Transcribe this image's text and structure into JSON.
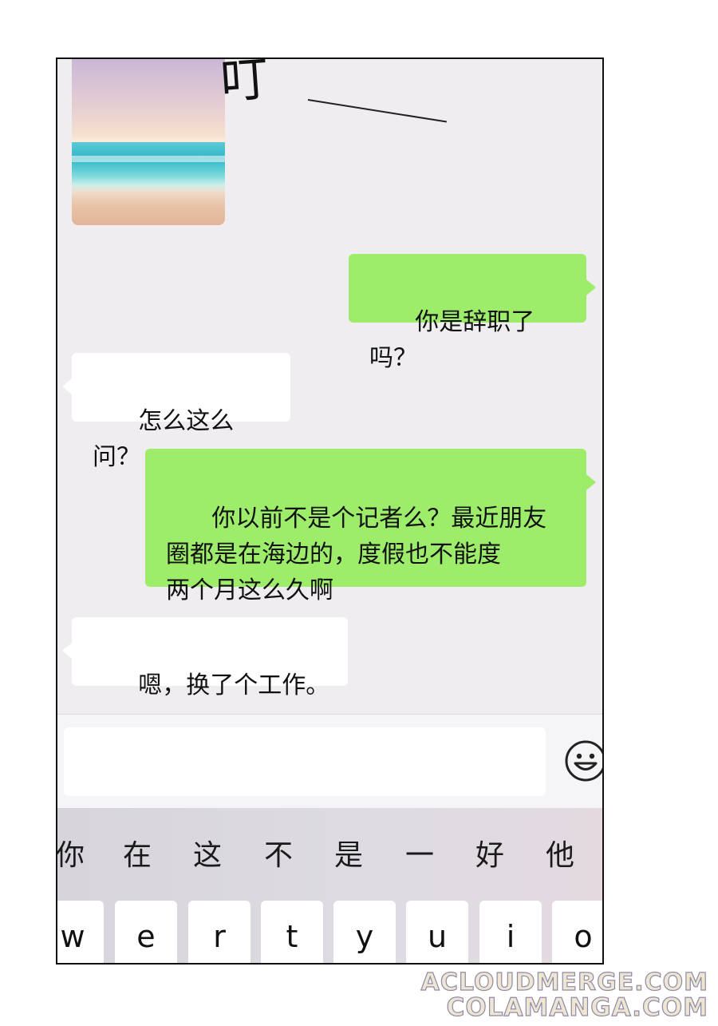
{
  "sound_effect": "叮",
  "messages": [
    {
      "side": "sent",
      "text": "你是辞职了吗？"
    },
    {
      "side": "received",
      "text": "怎么这么问？"
    },
    {
      "side": "sent",
      "text": "你以前不是个记者么？最近朋友\n圈都是在海边的，度假也不能度\n两个月这么久啊"
    },
    {
      "side": "received",
      "text": "嗯，换了个工作。"
    }
  ],
  "input": {
    "value": "",
    "emoji_icon": "smiley-face-icon"
  },
  "keyboard": {
    "candidates": [
      "你",
      "在",
      "这",
      "不",
      "是",
      "一",
      "好",
      "他"
    ],
    "keys": [
      "w",
      "e",
      "r",
      "t",
      "y",
      "u",
      "i",
      "o"
    ]
  },
  "watermarks": [
    "ACLOUDMERGE.COM",
    "COLAMANGA.COM"
  ]
}
